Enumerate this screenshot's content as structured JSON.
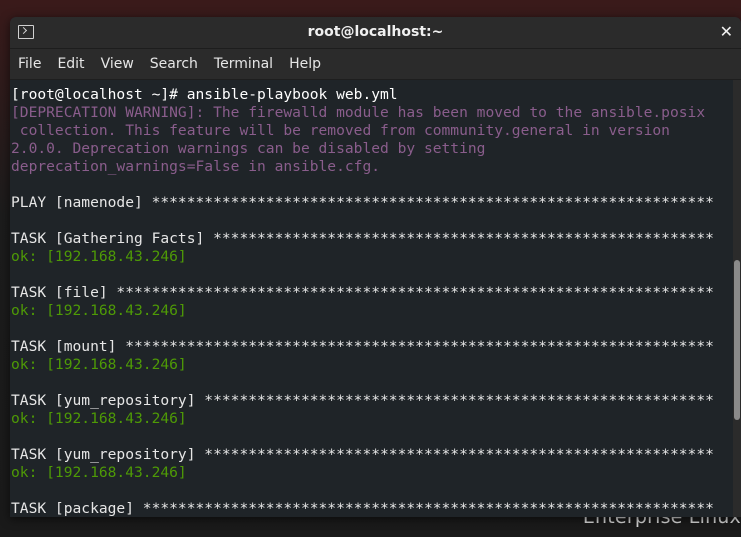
{
  "desktop": {
    "brand": "Enterprise Linux"
  },
  "window": {
    "title": "root@localhost:~",
    "close_glyph": "✕"
  },
  "menubar": {
    "items": [
      "File",
      "Edit",
      "View",
      "Search",
      "Terminal",
      "Help"
    ]
  },
  "terminal": {
    "lines": [
      {
        "text": "[root@localhost ~]# ansible-playbook web.yml",
        "style": "prompt"
      },
      {
        "text": "[DEPRECATION WARNING]: The firewalld module has been moved to the ansible.posix",
        "style": "warn"
      },
      {
        "text": " collection. This feature will be removed from community.general in version",
        "style": "warn"
      },
      {
        "text": "2.0.0. Deprecation warnings can be disabled by setting",
        "style": "warn"
      },
      {
        "text": "deprecation_warnings=False in ansible.cfg.",
        "style": "warn"
      },
      {
        "text": "",
        "style": "normal"
      },
      {
        "text": "PLAY [namenode] ****************************************************************",
        "style": "normal"
      },
      {
        "text": "",
        "style": "normal"
      },
      {
        "text": "TASK [Gathering Facts] *********************************************************",
        "style": "normal"
      },
      {
        "text": "ok: [192.168.43.246]",
        "style": "ok"
      },
      {
        "text": "",
        "style": "normal"
      },
      {
        "text": "TASK [file] ********************************************************************",
        "style": "normal"
      },
      {
        "text": "ok: [192.168.43.246]",
        "style": "ok"
      },
      {
        "text": "",
        "style": "normal"
      },
      {
        "text": "TASK [mount] *******************************************************************",
        "style": "normal"
      },
      {
        "text": "ok: [192.168.43.246]",
        "style": "ok"
      },
      {
        "text": "",
        "style": "normal"
      },
      {
        "text": "TASK [yum_repository] **********************************************************",
        "style": "normal"
      },
      {
        "text": "ok: [192.168.43.246]",
        "style": "ok"
      },
      {
        "text": "",
        "style": "normal"
      },
      {
        "text": "TASK [yum_repository] **********************************************************",
        "style": "normal"
      },
      {
        "text": "ok: [192.168.43.246]",
        "style": "ok"
      },
      {
        "text": "",
        "style": "normal"
      },
      {
        "text": "TASK [package] *****************************************************************",
        "style": "normal"
      }
    ]
  },
  "colors": {
    "terminal_bg": "#1f2428",
    "warning": "#8a5d8c",
    "ok": "#4e9a06",
    "chrome": "#2b2b2b"
  }
}
